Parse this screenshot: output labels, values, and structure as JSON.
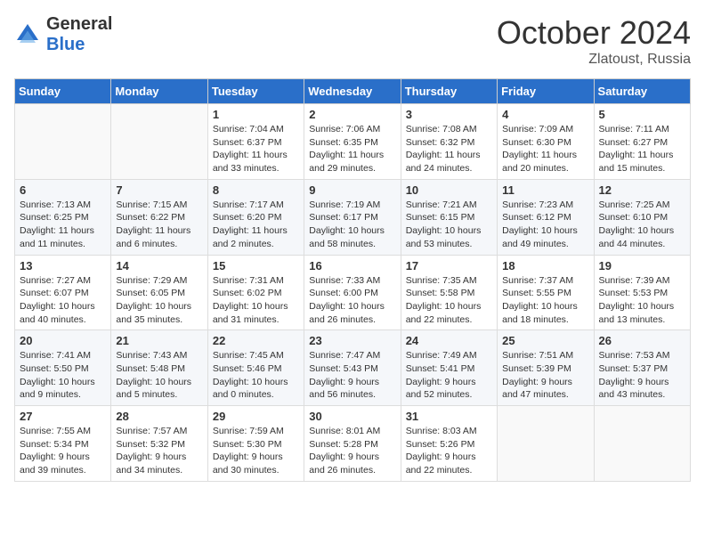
{
  "logo": {
    "line1": "General",
    "line2": "Blue"
  },
  "title": "October 2024",
  "location": "Zlatoust, Russia",
  "days_header": [
    "Sunday",
    "Monday",
    "Tuesday",
    "Wednesday",
    "Thursday",
    "Friday",
    "Saturday"
  ],
  "weeks": [
    [
      {
        "day": "",
        "content": ""
      },
      {
        "day": "",
        "content": ""
      },
      {
        "day": "1",
        "content": "Sunrise: 7:04 AM\nSunset: 6:37 PM\nDaylight: 11 hours\nand 33 minutes."
      },
      {
        "day": "2",
        "content": "Sunrise: 7:06 AM\nSunset: 6:35 PM\nDaylight: 11 hours\nand 29 minutes."
      },
      {
        "day": "3",
        "content": "Sunrise: 7:08 AM\nSunset: 6:32 PM\nDaylight: 11 hours\nand 24 minutes."
      },
      {
        "day": "4",
        "content": "Sunrise: 7:09 AM\nSunset: 6:30 PM\nDaylight: 11 hours\nand 20 minutes."
      },
      {
        "day": "5",
        "content": "Sunrise: 7:11 AM\nSunset: 6:27 PM\nDaylight: 11 hours\nand 15 minutes."
      }
    ],
    [
      {
        "day": "6",
        "content": "Sunrise: 7:13 AM\nSunset: 6:25 PM\nDaylight: 11 hours\nand 11 minutes."
      },
      {
        "day": "7",
        "content": "Sunrise: 7:15 AM\nSunset: 6:22 PM\nDaylight: 11 hours\nand 6 minutes."
      },
      {
        "day": "8",
        "content": "Sunrise: 7:17 AM\nSunset: 6:20 PM\nDaylight: 11 hours\nand 2 minutes."
      },
      {
        "day": "9",
        "content": "Sunrise: 7:19 AM\nSunset: 6:17 PM\nDaylight: 10 hours\nand 58 minutes."
      },
      {
        "day": "10",
        "content": "Sunrise: 7:21 AM\nSunset: 6:15 PM\nDaylight: 10 hours\nand 53 minutes."
      },
      {
        "day": "11",
        "content": "Sunrise: 7:23 AM\nSunset: 6:12 PM\nDaylight: 10 hours\nand 49 minutes."
      },
      {
        "day": "12",
        "content": "Sunrise: 7:25 AM\nSunset: 6:10 PM\nDaylight: 10 hours\nand 44 minutes."
      }
    ],
    [
      {
        "day": "13",
        "content": "Sunrise: 7:27 AM\nSunset: 6:07 PM\nDaylight: 10 hours\nand 40 minutes."
      },
      {
        "day": "14",
        "content": "Sunrise: 7:29 AM\nSunset: 6:05 PM\nDaylight: 10 hours\nand 35 minutes."
      },
      {
        "day": "15",
        "content": "Sunrise: 7:31 AM\nSunset: 6:02 PM\nDaylight: 10 hours\nand 31 minutes."
      },
      {
        "day": "16",
        "content": "Sunrise: 7:33 AM\nSunset: 6:00 PM\nDaylight: 10 hours\nand 26 minutes."
      },
      {
        "day": "17",
        "content": "Sunrise: 7:35 AM\nSunset: 5:58 PM\nDaylight: 10 hours\nand 22 minutes."
      },
      {
        "day": "18",
        "content": "Sunrise: 7:37 AM\nSunset: 5:55 PM\nDaylight: 10 hours\nand 18 minutes."
      },
      {
        "day": "19",
        "content": "Sunrise: 7:39 AM\nSunset: 5:53 PM\nDaylight: 10 hours\nand 13 minutes."
      }
    ],
    [
      {
        "day": "20",
        "content": "Sunrise: 7:41 AM\nSunset: 5:50 PM\nDaylight: 10 hours\nand 9 minutes."
      },
      {
        "day": "21",
        "content": "Sunrise: 7:43 AM\nSunset: 5:48 PM\nDaylight: 10 hours\nand 5 minutes."
      },
      {
        "day": "22",
        "content": "Sunrise: 7:45 AM\nSunset: 5:46 PM\nDaylight: 10 hours\nand 0 minutes."
      },
      {
        "day": "23",
        "content": "Sunrise: 7:47 AM\nSunset: 5:43 PM\nDaylight: 9 hours\nand 56 minutes."
      },
      {
        "day": "24",
        "content": "Sunrise: 7:49 AM\nSunset: 5:41 PM\nDaylight: 9 hours\nand 52 minutes."
      },
      {
        "day": "25",
        "content": "Sunrise: 7:51 AM\nSunset: 5:39 PM\nDaylight: 9 hours\nand 47 minutes."
      },
      {
        "day": "26",
        "content": "Sunrise: 7:53 AM\nSunset: 5:37 PM\nDaylight: 9 hours\nand 43 minutes."
      }
    ],
    [
      {
        "day": "27",
        "content": "Sunrise: 7:55 AM\nSunset: 5:34 PM\nDaylight: 9 hours\nand 39 minutes."
      },
      {
        "day": "28",
        "content": "Sunrise: 7:57 AM\nSunset: 5:32 PM\nDaylight: 9 hours\nand 34 minutes."
      },
      {
        "day": "29",
        "content": "Sunrise: 7:59 AM\nSunset: 5:30 PM\nDaylight: 9 hours\nand 30 minutes."
      },
      {
        "day": "30",
        "content": "Sunrise: 8:01 AM\nSunset: 5:28 PM\nDaylight: 9 hours\nand 26 minutes."
      },
      {
        "day": "31",
        "content": "Sunrise: 8:03 AM\nSunset: 5:26 PM\nDaylight: 9 hours\nand 22 minutes."
      },
      {
        "day": "",
        "content": ""
      },
      {
        "day": "",
        "content": ""
      }
    ]
  ]
}
